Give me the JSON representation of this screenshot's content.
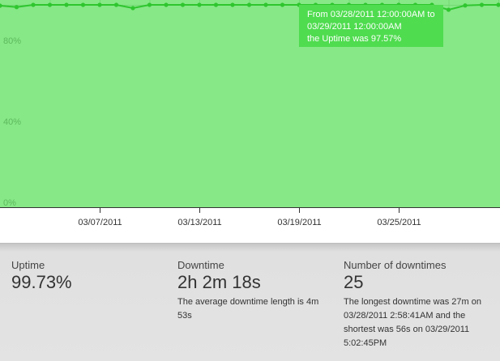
{
  "chart_data": {
    "type": "area",
    "title": "",
    "xlabel": "",
    "ylabel": "",
    "ylim": [
      0,
      100
    ],
    "y_ticks": [
      "0%",
      "40%",
      "80%"
    ],
    "x_ticks": [
      "03/07/2011",
      "03/13/2011",
      "03/19/2011",
      "03/25/2011"
    ],
    "grid": true,
    "fill_color": "#86e886",
    "line_color": "#2fc62f",
    "series": [
      {
        "x": [
          "03/01/2011",
          "03/02/2011",
          "03/03/2011",
          "03/04/2011",
          "03/05/2011",
          "03/06/2011",
          "03/07/2011",
          "03/08/2011",
          "03/09/2011",
          "03/10/2011",
          "03/11/2011",
          "03/12/2011",
          "03/13/2011",
          "03/14/2011",
          "03/15/2011",
          "03/16/2011",
          "03/17/2011",
          "03/18/2011",
          "03/19/2011",
          "03/20/2011",
          "03/21/2011",
          "03/22/2011",
          "03/23/2011",
          "03/24/2011",
          "03/25/2011",
          "03/26/2011",
          "03/27/2011",
          "03/28/2011",
          "03/29/2011",
          "03/30/2011",
          "03/31/2011"
        ],
        "values": [
          99.6,
          98.9,
          100,
          100,
          100,
          100,
          100,
          100,
          98.4,
          100,
          100,
          100,
          100,
          100,
          100,
          100,
          100,
          100,
          100,
          100,
          100,
          100,
          100,
          100,
          100,
          100,
          100,
          97.57,
          99.7,
          100,
          100
        ]
      }
    ]
  },
  "tooltip": {
    "line1": "From 03/28/2011 12:00:00AM to",
    "line2": "03/29/2011 12:00:00AM",
    "line3": "the Uptime was 97.57%"
  },
  "stats": {
    "uptime": {
      "label": "Uptime",
      "value": "99.73%"
    },
    "downtime": {
      "label": "Downtime",
      "value": "2h 2m 18s",
      "note": "The average downtime length is 4m 53s"
    },
    "downtimes": {
      "label": "Number of downtimes",
      "value": "25",
      "note": "The longest downtime was 27m on 03/28/2011 2:58:41AM and the shortest was 56s on 03/29/2011 5:02:45PM"
    }
  }
}
